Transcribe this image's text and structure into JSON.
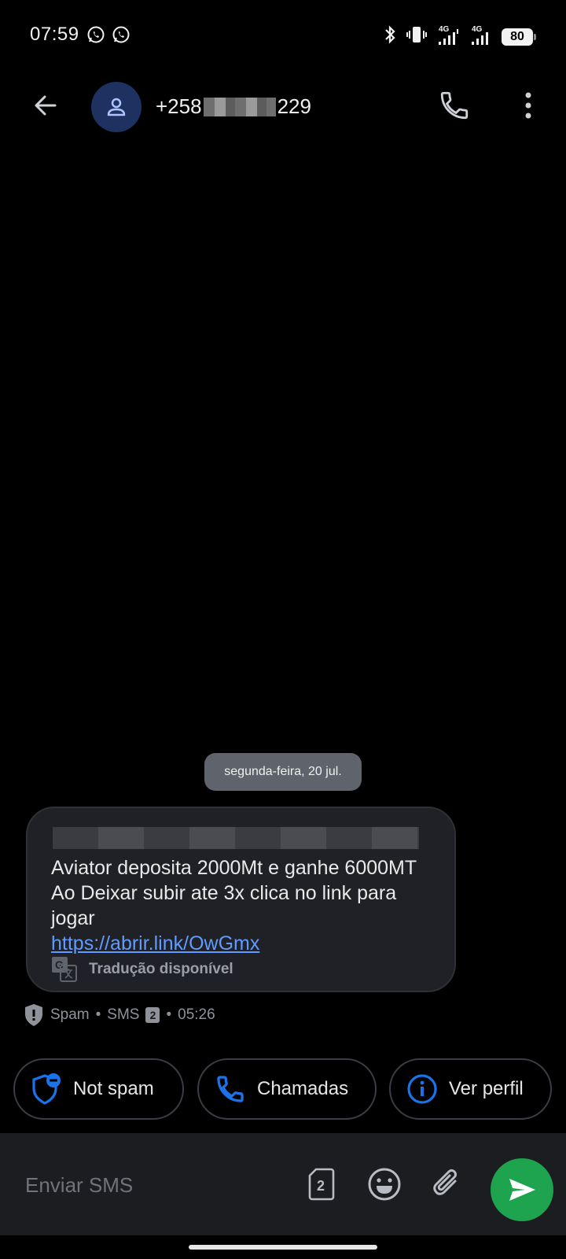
{
  "status_bar": {
    "time": "07:59",
    "left_icons": [
      "whatsapp-icon",
      "whatsapp-icon"
    ],
    "right_icons": [
      "bluetooth-icon",
      "vibrate-icon",
      "signal-4g-icon",
      "signal-4g-icon"
    ],
    "network_label_1": "4G",
    "network_label_2": "4G",
    "battery_level": "80"
  },
  "header": {
    "contact_prefix": "+258",
    "contact_suffix": "229"
  },
  "conversation": {
    "date_label": "segunda-feira, 20 jul.",
    "message": {
      "text": "Aviator deposita 2000Mt e ganhe 6000MT Ao Deixar subir ate 3x clica no link para jogar",
      "link": "https://abrir.link/OwGmx",
      "translate_label": "Tradução disponível"
    },
    "meta": {
      "spam_label": "Spam",
      "separator": "•",
      "channel": "SMS",
      "sim": "2",
      "time": "05:26"
    }
  },
  "actions": {
    "not_spam": "Not spam",
    "calls": "Chamadas",
    "profile": "Ver perfil"
  },
  "compose": {
    "placeholder": "Enviar SMS",
    "sim": "2"
  },
  "colors": {
    "background": "#000000",
    "bubble": "#1f2126",
    "accent_blue": "#1a73e8",
    "link": "#5f9bff",
    "send_green": "#1ea44f",
    "avatar_bg": "#1d3260"
  }
}
